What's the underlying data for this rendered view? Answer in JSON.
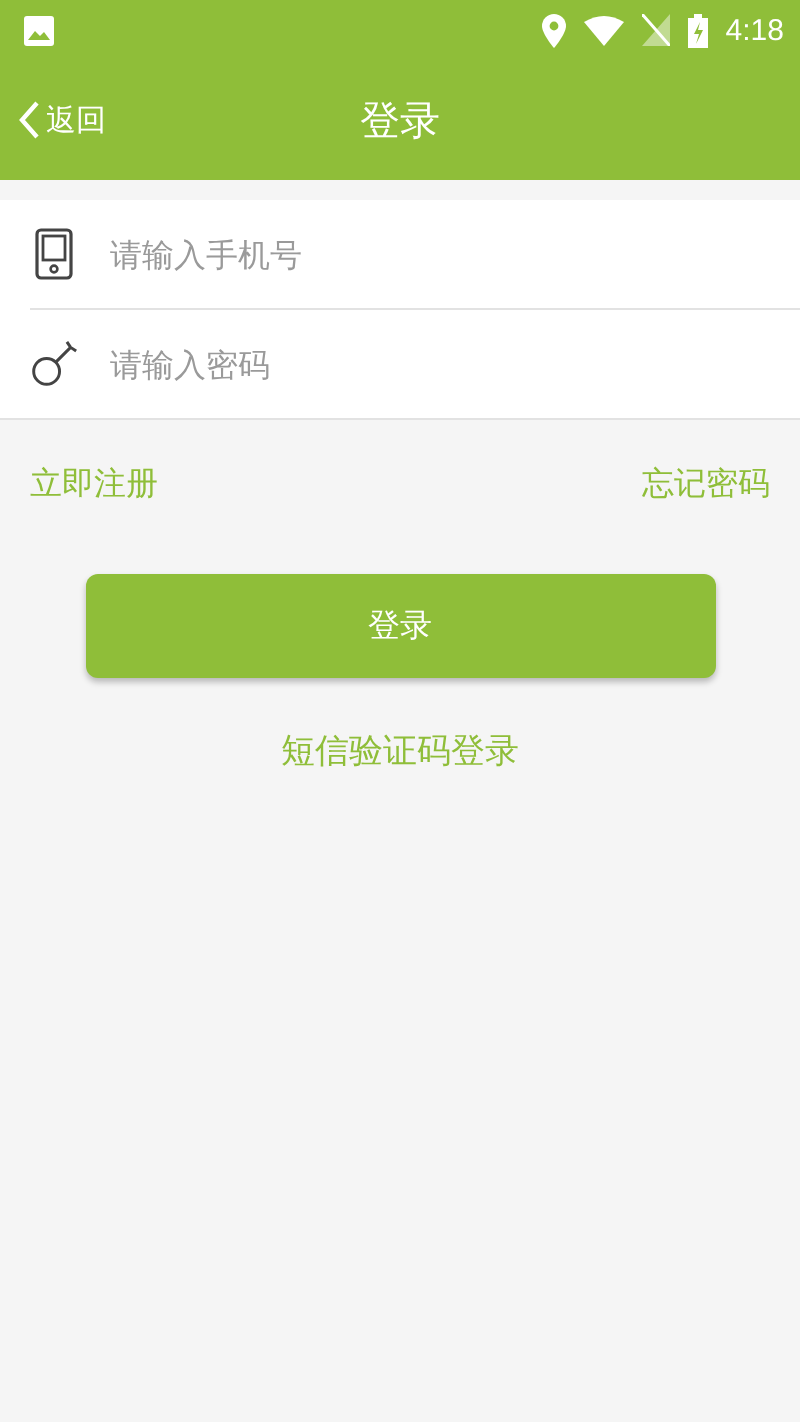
{
  "status_bar": {
    "time": "4:18"
  },
  "app_bar": {
    "back": "返回",
    "title": "登录"
  },
  "fields": [
    {
      "kind": "phone",
      "placeholder": "请输入手机号"
    },
    {
      "kind": "password",
      "placeholder": "请输入密码"
    }
  ],
  "links": {
    "register": "立即注册",
    "forgot": "忘记密码"
  },
  "login_button": "登录",
  "sms_login": "短信验证码登录"
}
